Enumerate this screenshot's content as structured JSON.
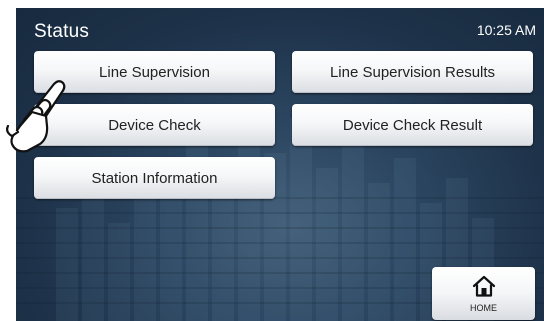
{
  "header": {
    "title": "Status",
    "time": "10:25 AM"
  },
  "buttons": {
    "line_supervision": "Line Supervision",
    "line_supervision_results": "Line Supervision Results",
    "device_check": "Device Check",
    "device_check_result": "Device Check Result",
    "station_information": "Station Information"
  },
  "home": {
    "label": "HOME",
    "icon": "home-icon"
  },
  "overlay": {
    "icon": "pointing-hand-icon"
  },
  "colors": {
    "screen_bg": "#1d3148",
    "button_bg": "#f6f7f9",
    "text_light": "#ffffff",
    "text_dark": "#222222"
  }
}
